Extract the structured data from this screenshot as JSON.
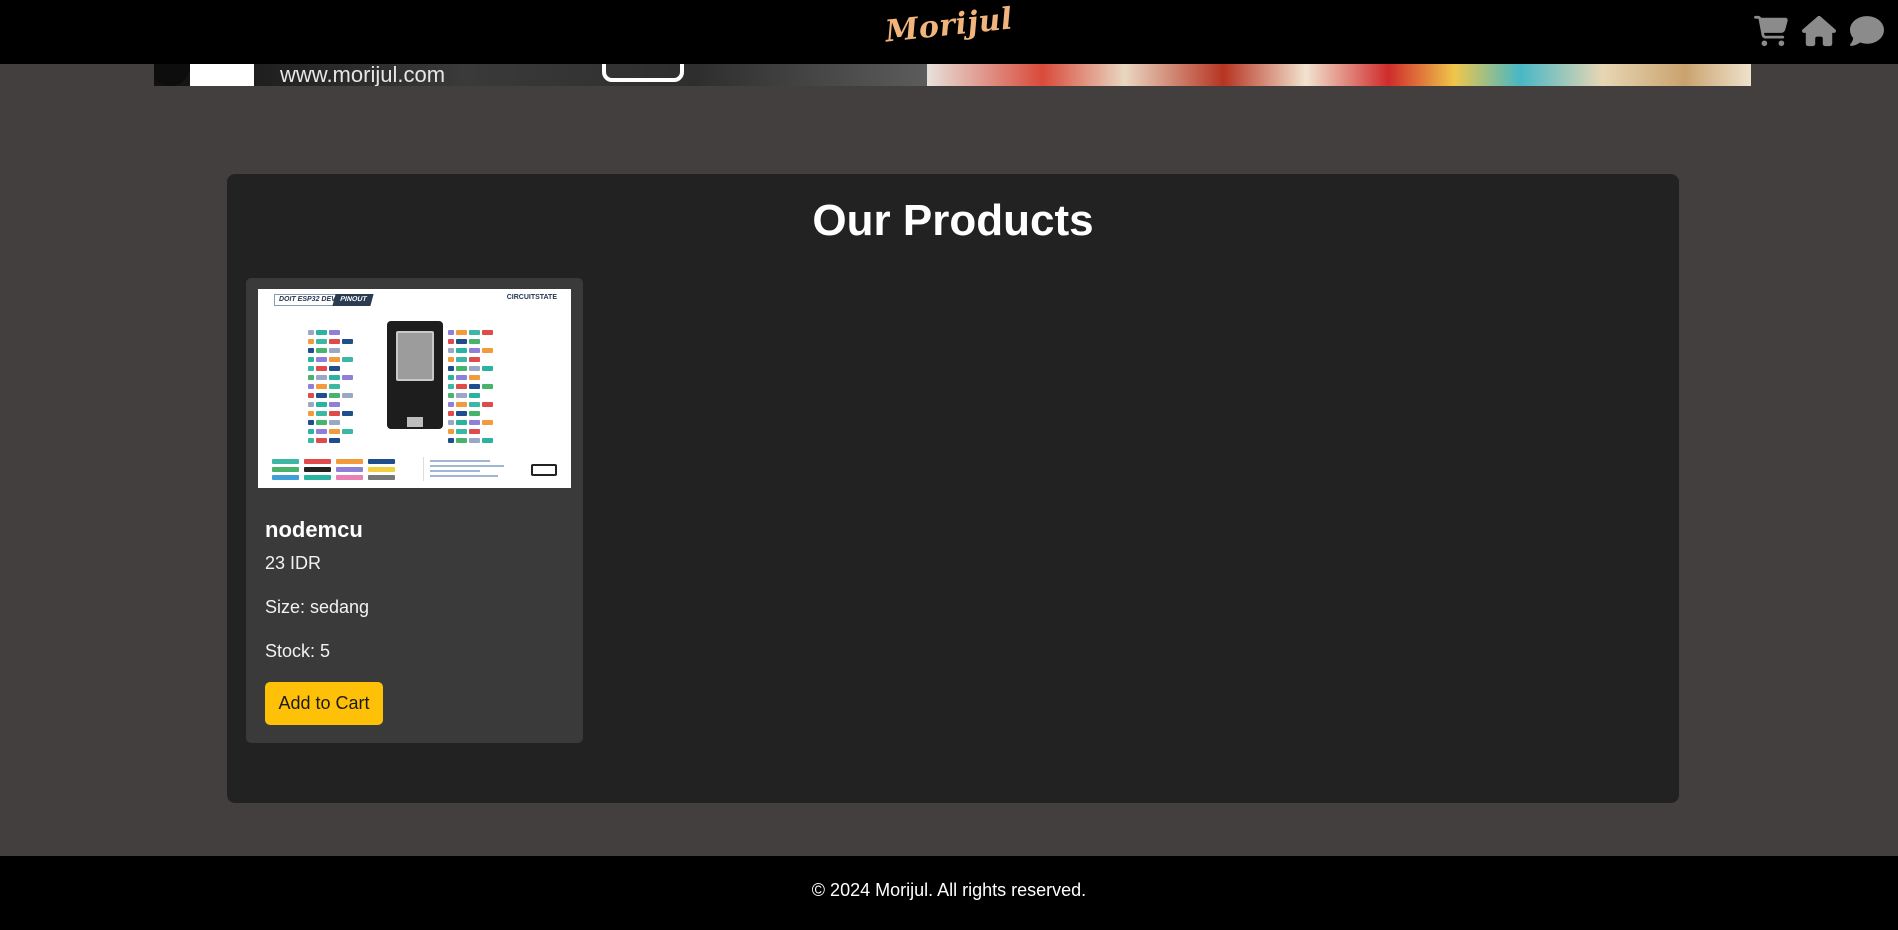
{
  "header": {
    "logo_text": "Morijul",
    "icons": [
      "cart-icon",
      "home-icon",
      "chat-icon"
    ]
  },
  "banner": {
    "url_text": "www.morijul.com"
  },
  "main": {
    "title": "Our Products",
    "products": [
      {
        "name": "nodemcu",
        "price": "23 IDR",
        "size": "Size: sedang",
        "stock": "Stock: 5",
        "button_label": "Add to Cart",
        "image": {
          "title": "DOIT ESP32 DEVKIT V1",
          "badge": "PINOUT",
          "brand": "CIRCUITSTATE"
        }
      }
    ]
  },
  "footer": {
    "text": "© 2024 Morijul. All rights reserved."
  },
  "colors": {
    "page_bg": "#433f3e",
    "header_bg": "#000000",
    "card_bg": "#222222",
    "product_bg": "#3a3a3a",
    "button_bg": "#ffc107",
    "logo": "#f0b47c",
    "icon": "#8b8b8b"
  }
}
